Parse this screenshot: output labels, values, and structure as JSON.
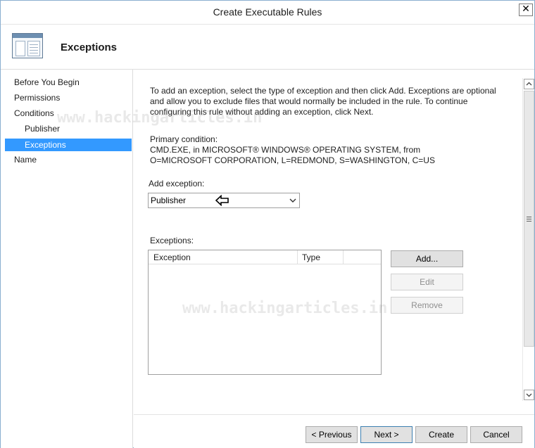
{
  "window": {
    "title": "Create Executable Rules",
    "close_glyph": "✕"
  },
  "header": {
    "heading": "Exceptions"
  },
  "nav": {
    "items": [
      {
        "label": "Before You Begin"
      },
      {
        "label": "Permissions"
      },
      {
        "label": "Conditions"
      },
      {
        "label": "Publisher"
      },
      {
        "label": "Exceptions"
      },
      {
        "label": "Name"
      }
    ],
    "selected": "Exceptions"
  },
  "content": {
    "description": "To add an exception, select the type of exception and then click Add. Exceptions are optional and allow you to exclude files that would normally be included in the rule. To continue configuring this rule without adding an exception, click Next.",
    "primary_condition_label": "Primary condition:",
    "primary_condition_value": "CMD.EXE, in MICROSOFT® WINDOWS® OPERATING SYSTEM, from O=MICROSOFT CORPORATION, L=REDMOND, S=WASHINGTON, C=US",
    "add_exception_label": "Add exception:",
    "add_exception_selected": "Publisher",
    "exceptions_label": "Exceptions:",
    "columns": [
      "Exception",
      "Type"
    ],
    "buttons": {
      "add": "Add...",
      "edit": "Edit",
      "remove": "Remove"
    }
  },
  "footer": {
    "previous": "< Previous",
    "next": "Next >",
    "create": "Create",
    "cancel": "Cancel"
  },
  "watermark": "www.hackingarticles.in",
  "colors": {
    "selection": "#3399ff",
    "window_border": "#8aaed0"
  }
}
